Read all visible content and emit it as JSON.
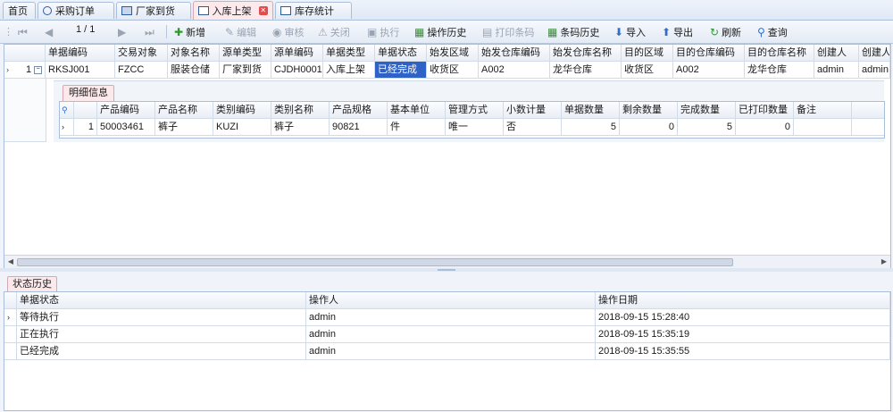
{
  "tabs": [
    {
      "label": "首页",
      "icon": "none"
    },
    {
      "label": "采购订单",
      "icon": "clock-icon"
    },
    {
      "label": "厂家到货",
      "icon": "truck-icon"
    },
    {
      "label": "入库上架",
      "icon": "document-icon",
      "active": true
    },
    {
      "label": "库存统计",
      "icon": "document-icon"
    }
  ],
  "toolbar": {
    "pager": "1 / 1",
    "buttons": [
      {
        "label": "新增",
        "icon": "plus-icon",
        "enabled": true
      },
      {
        "label": "编辑",
        "icon": "edit-icon",
        "enabled": false
      },
      {
        "label": "审核",
        "icon": "audit-icon",
        "enabled": false
      },
      {
        "label": "关闭",
        "icon": "warning-icon",
        "enabled": false
      },
      {
        "label": "执行",
        "icon": "execute-icon",
        "enabled": false
      },
      {
        "label": "操作历史",
        "icon": "grid-icon",
        "enabled": true
      },
      {
        "label": "打印条码",
        "icon": "print-icon",
        "enabled": false
      },
      {
        "label": "条码历史",
        "icon": "grid-icon",
        "enabled": true
      },
      {
        "label": "导入",
        "icon": "arrow-down-icon",
        "enabled": true
      },
      {
        "label": "导出",
        "icon": "arrow-up-icon",
        "enabled": true
      },
      {
        "label": "刷新",
        "icon": "refresh-icon",
        "enabled": true
      },
      {
        "label": "查询",
        "icon": "search-icon",
        "enabled": true
      }
    ]
  },
  "main_grid": {
    "columns": [
      "单据编码",
      "交易对象",
      "对象名称",
      "源单类型",
      "源单编码",
      "单据类型",
      "单据状态",
      "始发区域",
      "始发仓库编码",
      "始发仓库名称",
      "目的区域",
      "目的仓库编码",
      "目的仓库名称",
      "创建人",
      "创建人"
    ],
    "rows": [
      {
        "index": "1",
        "values": [
          "RKSJ001",
          "FZCC",
          "服装仓储",
          "厂家到货",
          "CJDH0001",
          "入库上架",
          "已经完成",
          "收货区",
          "A002",
          "龙华仓库",
          "收货区",
          "A002",
          "龙华仓库",
          "admin",
          "admin"
        ]
      }
    ]
  },
  "detail": {
    "tab_label": "明细信息",
    "columns": [
      "产品编码",
      "产品名称",
      "类别编码",
      "类别名称",
      "产品规格",
      "基本单位",
      "管理方式",
      "小数计量",
      "单据数量",
      "剩余数量",
      "完成数量",
      "已打印数量",
      "备注"
    ],
    "rows": [
      {
        "index": "1",
        "values": [
          "50003461",
          "裤子",
          "KUZI",
          "裤子",
          "90821",
          "件",
          "唯一",
          "否",
          "5",
          "0",
          "5",
          "0",
          ""
        ]
      }
    ]
  },
  "history": {
    "tab_label": "状态历史",
    "columns": [
      "单据状态",
      "操作人",
      "操作日期"
    ],
    "rows": [
      [
        "等待执行",
        "admin",
        "2018-09-15 15:28:40"
      ],
      [
        "正在执行",
        "admin",
        "2018-09-15 15:35:19"
      ],
      [
        "已经完成",
        "admin",
        "2018-09-15 15:35:55"
      ]
    ]
  },
  "colors": {
    "accent": "#2f62c6",
    "tab_active": "#fbe9ec",
    "border": "#a9bed8"
  }
}
